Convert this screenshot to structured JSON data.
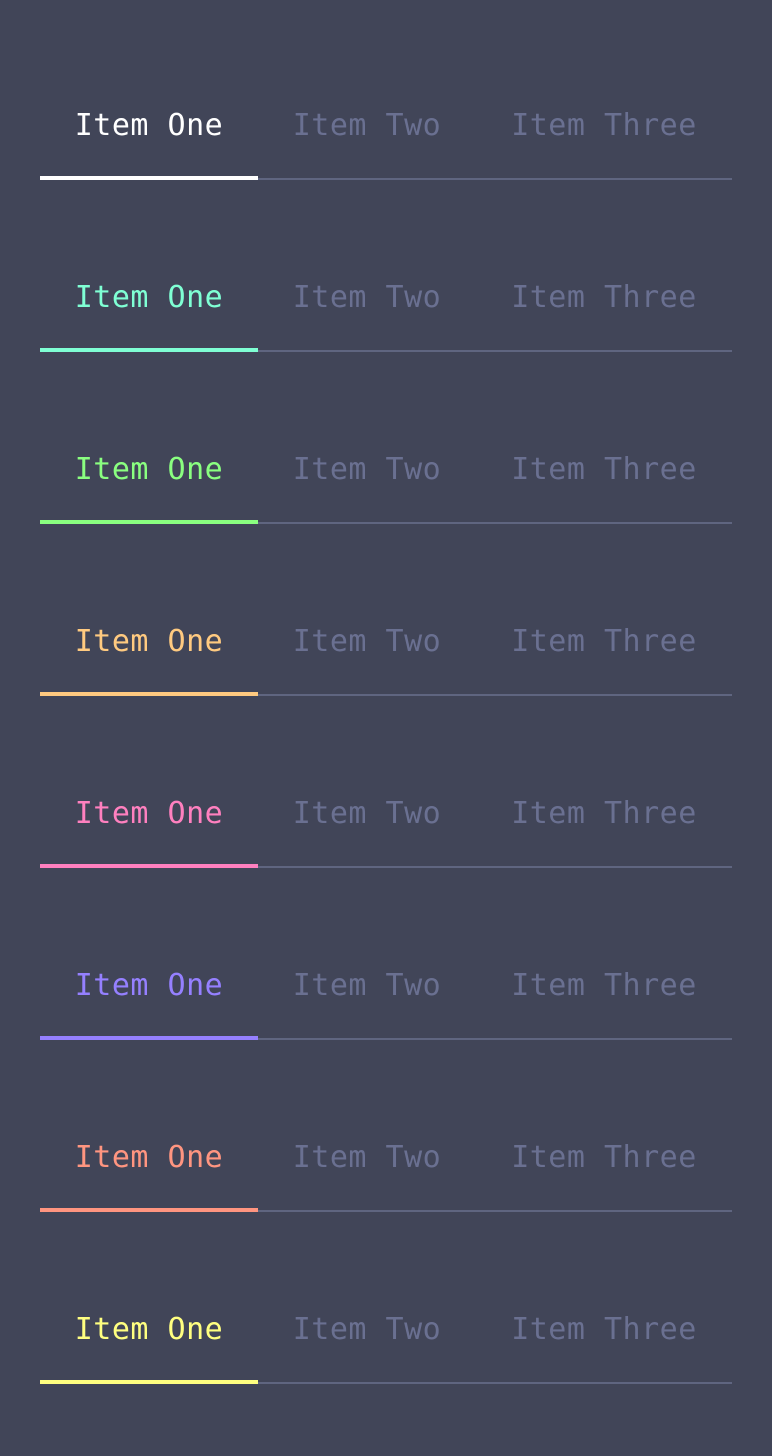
{
  "tab_labels": [
    "Item One",
    "Item Two",
    "Item Three"
  ],
  "inactive_color": "#6a7091",
  "baseline_color": "#5f6580",
  "background_color": "#414558",
  "tab_bars": [
    {
      "name": "white",
      "accent": "#ffffff",
      "active_index": 0
    },
    {
      "name": "cyan",
      "accent": "#7fffd4",
      "active_index": 0
    },
    {
      "name": "green",
      "accent": "#8aff80",
      "active_index": 0
    },
    {
      "name": "orange",
      "accent": "#ffca80",
      "active_index": 0
    },
    {
      "name": "pink",
      "accent": "#ff80bf",
      "active_index": 0
    },
    {
      "name": "purple",
      "accent": "#9580ff",
      "active_index": 0
    },
    {
      "name": "salmon",
      "accent": "#ff9580",
      "active_index": 0
    },
    {
      "name": "yellow",
      "accent": "#ffff80",
      "active_index": 0
    }
  ]
}
